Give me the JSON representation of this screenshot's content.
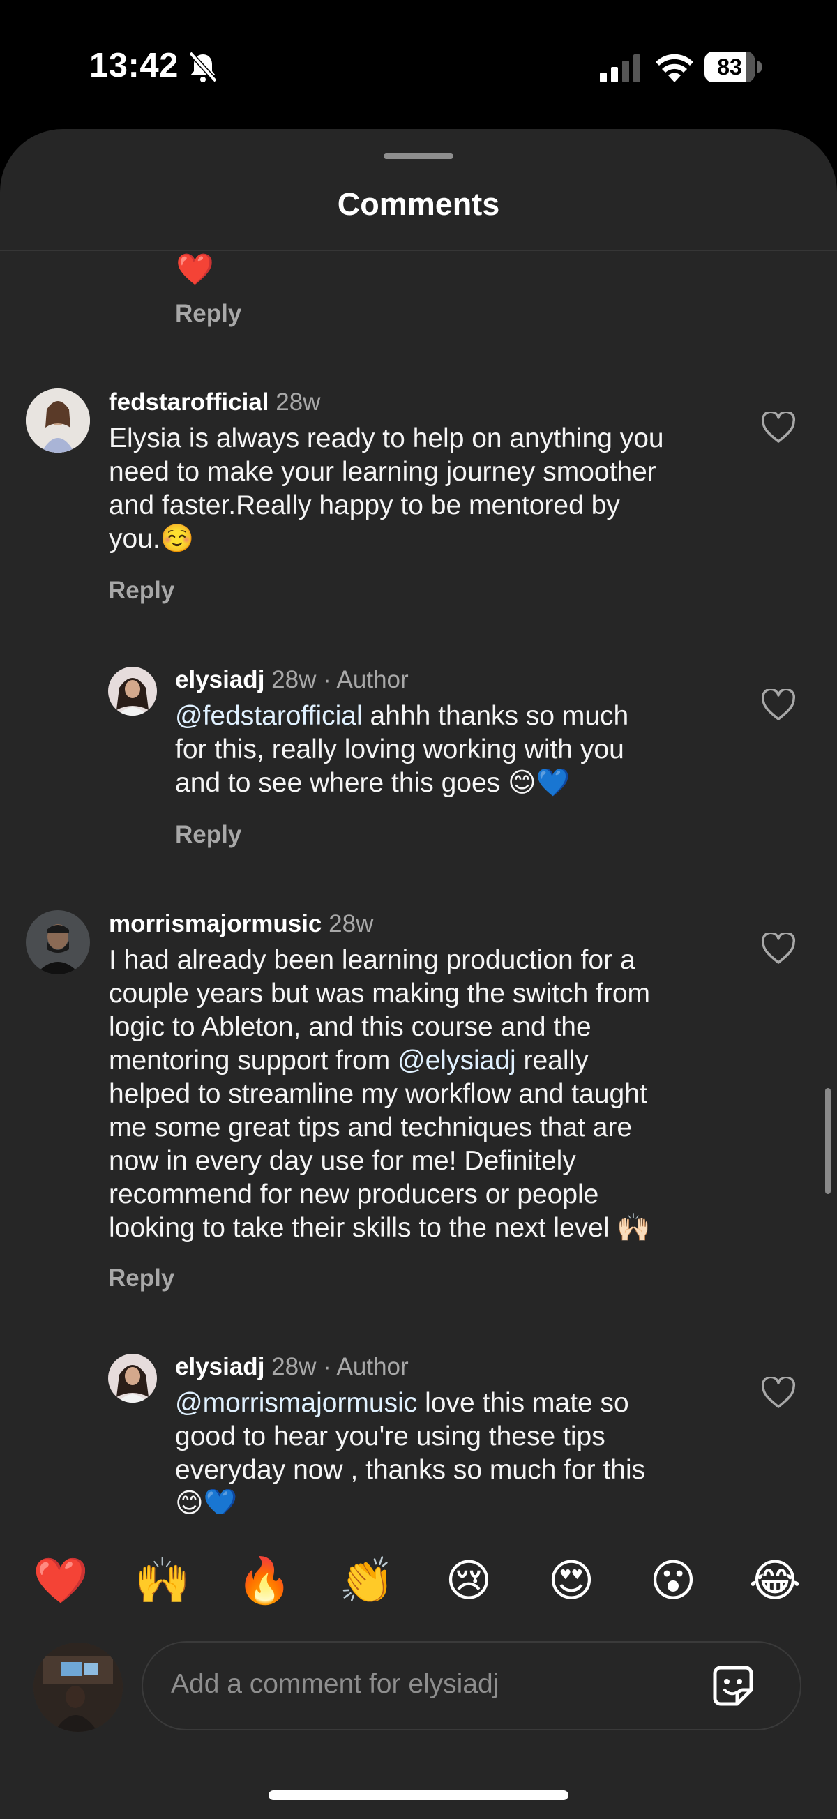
{
  "status_bar": {
    "time": "13:42",
    "battery": "83"
  },
  "sheet": {
    "title": "Comments"
  },
  "top_partial": {
    "emoji": "❤️",
    "reply_label": "Reply"
  },
  "comments": [
    {
      "username": "fedstarofficial",
      "time": "28w",
      "lines": [
        "Elysia is always ready to help on anything you",
        "need to make your learning journey smoother",
        "and faster.Really happy to be mentored by",
        "you.☺️"
      ],
      "reply_label": "Reply"
    },
    {
      "username": "elysiadj",
      "time": "28w",
      "author_tag": "· Author",
      "mention": "@fedstarofficial",
      "line1_rest": " ahhh thanks so much",
      "lines": [
        "for this, really loving working with you",
        "and to see where this goes 😊💙"
      ],
      "reply_label": "Reply"
    },
    {
      "username": "morrismajormusic",
      "time": "28w",
      "line1": "I had already been learning production for a",
      "line2": "couple years but was making the switch from",
      "line3": "logic to Ableton, and this course and the",
      "line4_pre": "mentoring support from ",
      "line4_mention": "@elysiadj",
      "line4_post": " really",
      "line5": "helped to streamline my workflow and taught",
      "line6": "me some great tips and techniques that are",
      "line7": "now in every day use for me! Definitely",
      "line8": "recommend for new producers or people",
      "line9": "looking to take their skills to the next level 🙌🏻",
      "reply_label": "Reply"
    },
    {
      "username": "elysiadj",
      "time": "28w",
      "author_tag": "· Author",
      "mention": "@morrismajormusic",
      "line1_rest": " love this mate so",
      "lines": [
        "good to hear you're using these tips",
        "everyday now , thanks so much for this",
        "😊💙"
      ]
    }
  ],
  "emoji_bar": [
    "❤️",
    "🙌",
    "🔥",
    "👏",
    "😢",
    "😍",
    "😮",
    "😂"
  ],
  "composer": {
    "placeholder": "Add a comment for elysiadj"
  },
  "colors": {
    "background": "#262626",
    "muted": "#a8a8a8",
    "mention": "#e0f1ff"
  },
  "icons": [
    "bell-slash-icon",
    "cellular-signal-icon",
    "wifi-icon",
    "battery-icon",
    "heart-outline-icon",
    "sticker-icon"
  ]
}
